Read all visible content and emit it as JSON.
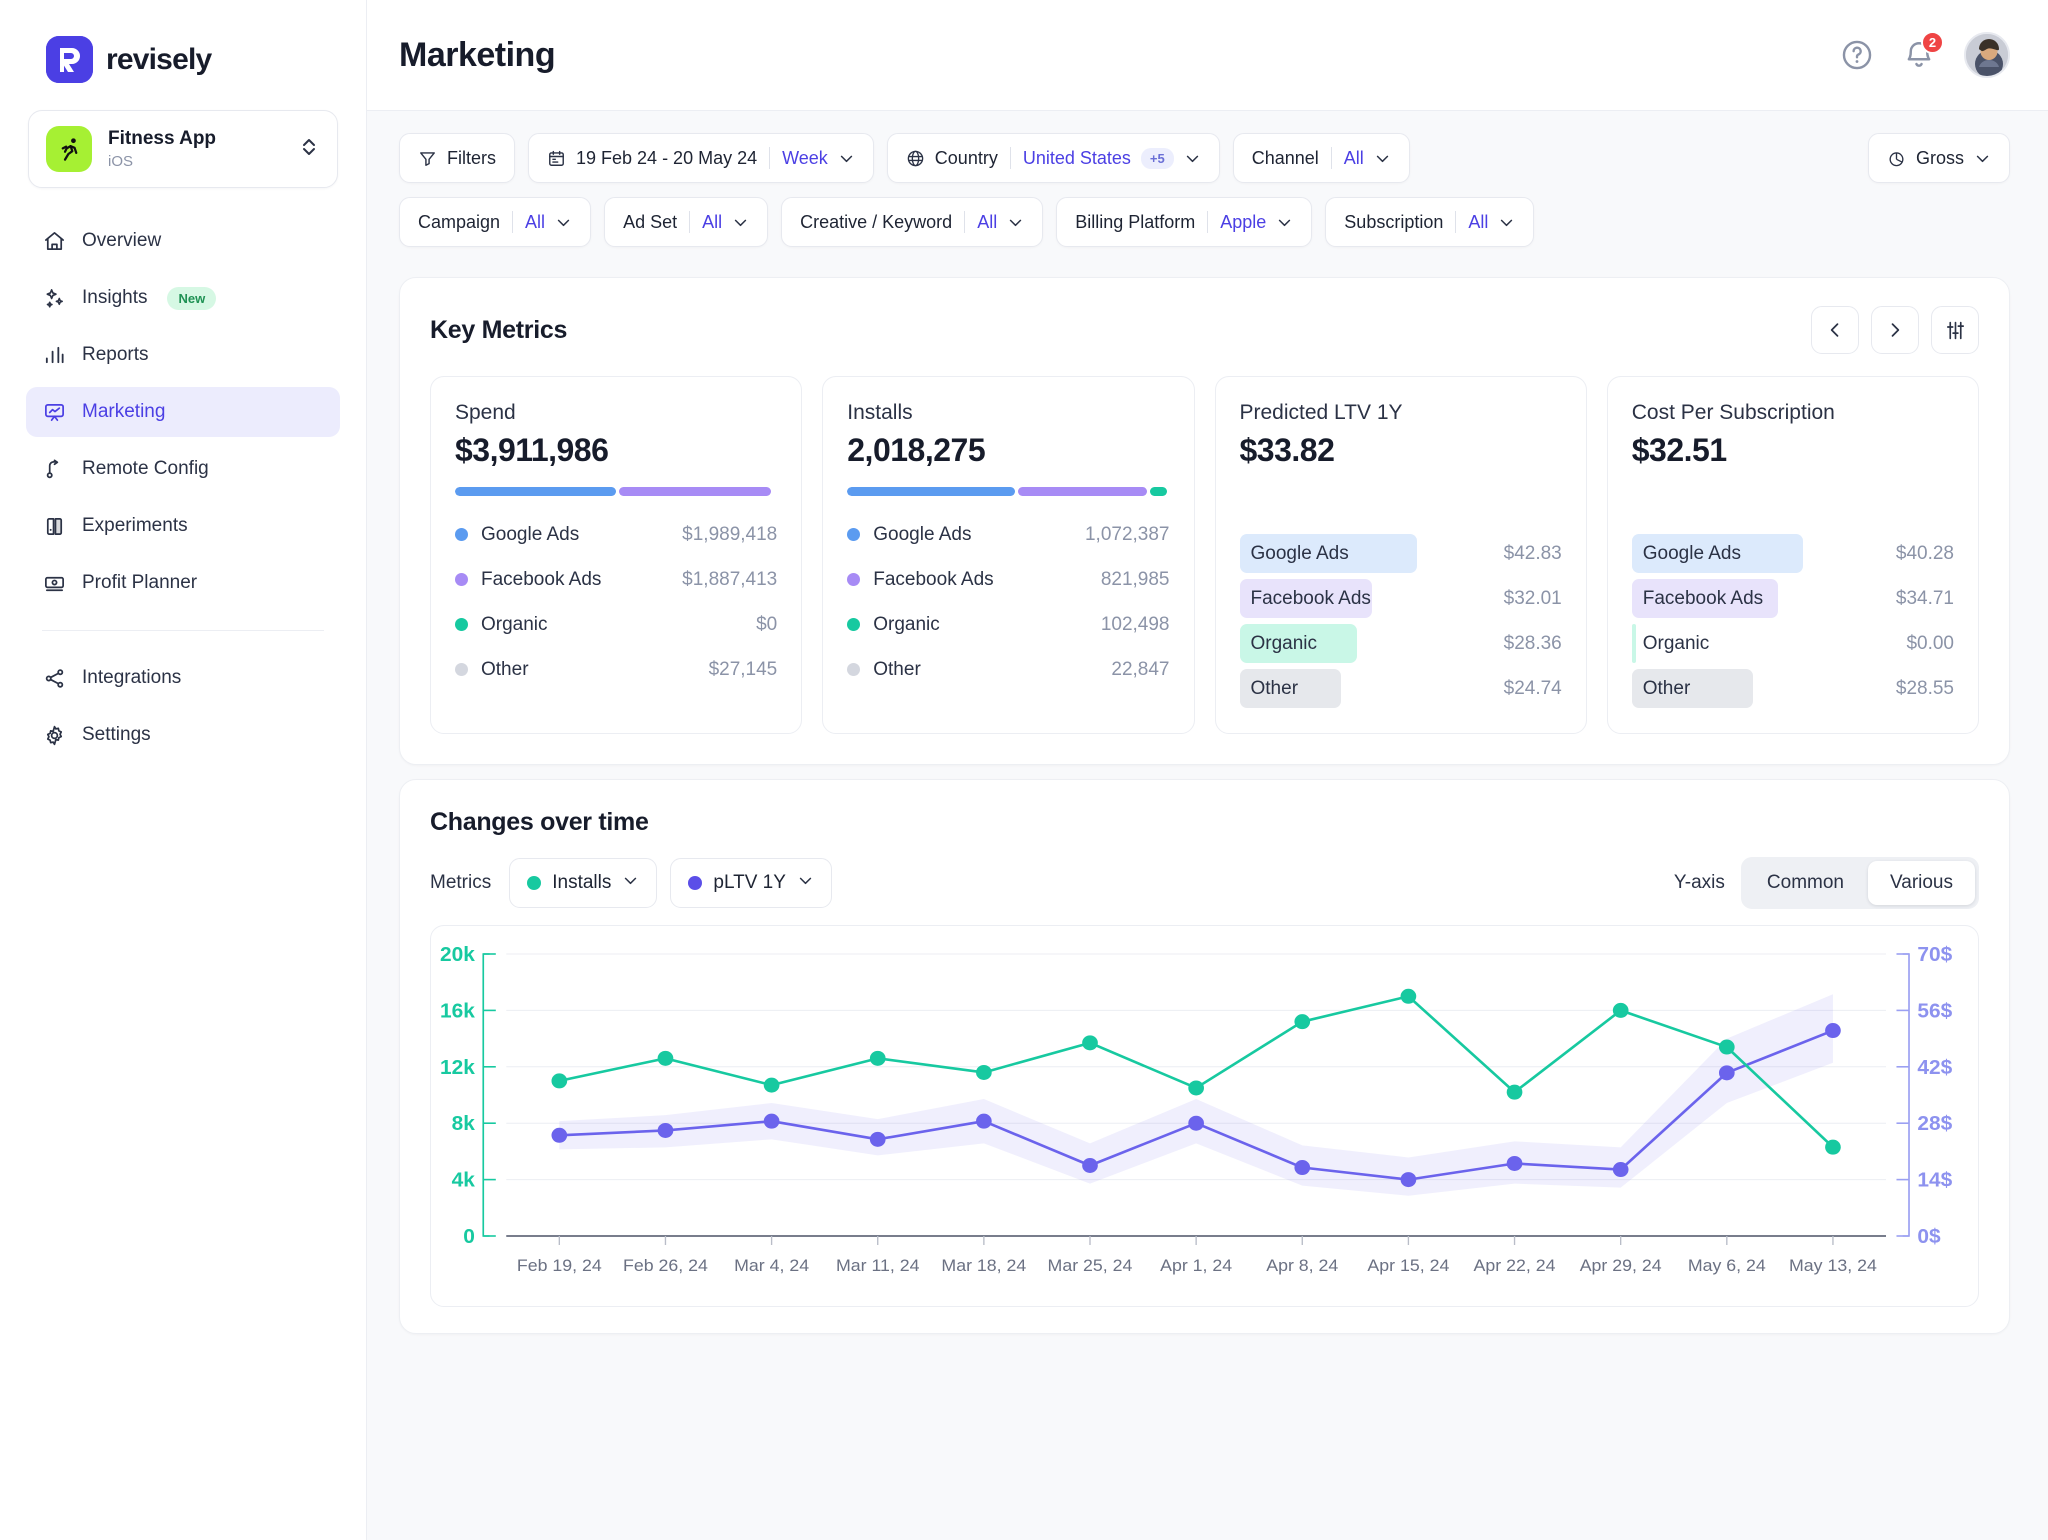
{
  "brand": {
    "name": "revisely",
    "logo_icon": "revisely-logo-icon"
  },
  "app_switcher": {
    "name": "Fitness App",
    "platform": "iOS",
    "icon": "running-person-icon",
    "chevron_icon": "chevron-up-down-icon"
  },
  "sidebar": {
    "items": [
      {
        "label": "Overview",
        "icon": "home-icon",
        "active": false
      },
      {
        "label": "Insights",
        "icon": "sparkles-icon",
        "active": false,
        "badge": "New"
      },
      {
        "label": "Reports",
        "icon": "bar-chart-icon",
        "active": false
      },
      {
        "label": "Marketing",
        "icon": "presentation-chart-icon",
        "active": true
      },
      {
        "label": "Remote Config",
        "icon": "branch-icon",
        "active": false
      },
      {
        "label": "Experiments",
        "icon": "flask-split-icon",
        "active": false
      },
      {
        "label": "Profit Planner",
        "icon": "banknote-icon",
        "active": false
      }
    ],
    "footer_items": [
      {
        "label": "Integrations",
        "icon": "share-nodes-icon"
      },
      {
        "label": "Settings",
        "icon": "gear-icon"
      }
    ]
  },
  "header": {
    "title": "Marketing",
    "help_icon": "question-circle-icon",
    "notifications_icon": "bell-icon",
    "notifications_count": "2",
    "avatar": "user-avatar"
  },
  "filters": {
    "row1": [
      {
        "type": "button",
        "name": "filters-button",
        "icon": "funnel-icon",
        "label": "Filters"
      },
      {
        "type": "daterange",
        "name": "date-range-filter",
        "icon": "calendar-icon",
        "label": "19 Feb 24 - 20 May 24",
        "value": "Week",
        "chevron": "chevron-down-icon"
      },
      {
        "type": "select",
        "name": "country-filter",
        "icon": "globe-icon",
        "label": "Country",
        "value": "United States",
        "extra": "+5",
        "chevron": "chevron-down-icon"
      },
      {
        "type": "select",
        "name": "channel-filter",
        "label": "Channel",
        "value": "All",
        "chevron": "chevron-down-icon"
      }
    ],
    "row2": [
      {
        "type": "select",
        "name": "campaign-filter",
        "label": "Campaign",
        "value": "All",
        "chevron": "chevron-down-icon"
      },
      {
        "type": "select",
        "name": "ad-set-filter",
        "label": "Ad Set",
        "value": "All",
        "chevron": "chevron-down-icon"
      },
      {
        "type": "select",
        "name": "creative-keyword-filter",
        "label": "Creative / Keyword",
        "value": "All",
        "chevron": "chevron-down-icon"
      },
      {
        "type": "select",
        "name": "billing-platform-filter",
        "label": "Billing Platform",
        "value": "Apple",
        "chevron": "chevron-down-icon"
      },
      {
        "type": "select",
        "name": "subscription-filter",
        "label": "Subscription",
        "value": "All",
        "chevron": "chevron-down-icon"
      }
    ],
    "gross": {
      "label": "Gross",
      "icon": "pie-slice-icon",
      "chevron": "chevron-down-icon"
    }
  },
  "key_metrics": {
    "title": "Key Metrics",
    "prev_icon": "chevron-left-icon",
    "next_icon": "chevron-right-icon",
    "settings_icon": "sliders-icon",
    "colors": {
      "google": "#5b9bf0",
      "facebook": "#a78bf5",
      "organic": "#17c9a0",
      "other": "#d4d7df",
      "google_bg": "#dceafc",
      "facebook_bg": "#e8e3fb",
      "organic_bg": "#c9f7e7",
      "other_bg": "#e6e8ec"
    },
    "cards": [
      {
        "label": "Spend",
        "value": "$3,911,986",
        "style": "stacked",
        "rows": [
          {
            "label": "Google Ads",
            "amount": "$1,989,418",
            "share": 50.9
          },
          {
            "label": "Facebook Ads",
            "amount": "$1,887,413",
            "share": 48.3
          },
          {
            "label": "Organic",
            "amount": "$0",
            "share": 0
          },
          {
            "label": "Other",
            "amount": "$27,145",
            "share": 0.8
          }
        ]
      },
      {
        "label": "Installs",
        "value": "2,018,275",
        "style": "stacked",
        "rows": [
          {
            "label": "Google Ads",
            "amount": "1,072,387",
            "share": 53.1
          },
          {
            "label": "Facebook Ads",
            "amount": "821,985",
            "share": 40.7
          },
          {
            "label": "Organic",
            "amount": "102,498",
            "share": 5.1
          },
          {
            "label": "Other",
            "amount": "22,847",
            "share": 1.1
          }
        ]
      },
      {
        "label": "Predicted LTV 1Y",
        "value": "$33.82",
        "style": "bars",
        "rows": [
          {
            "label": "Google Ads",
            "amount": "$42.83",
            "share": 100
          },
          {
            "label": "Facebook Ads",
            "amount": "$32.01",
            "share": 74.7
          },
          {
            "label": "Organic",
            "amount": "$28.36",
            "share": 66.2
          },
          {
            "label": "Other",
            "amount": "$24.74",
            "share": 57.8
          }
        ]
      },
      {
        "label": "Cost Per Subscription",
        "value": "$32.51",
        "style": "bars",
        "rows": [
          {
            "label": "Google Ads",
            "amount": "$40.28",
            "share": 100
          },
          {
            "label": "Facebook Ads",
            "amount": "$34.71",
            "share": 86.2
          },
          {
            "label": "Organic",
            "amount": "$0.00",
            "share": 0.6
          },
          {
            "label": "Other",
            "amount": "$28.55",
            "share": 70.9
          }
        ]
      }
    ]
  },
  "changes_over_time": {
    "title": "Changes over time",
    "metrics_label": "Metrics",
    "metric_pills": [
      {
        "label": "Installs",
        "color": "#17c9a0",
        "chevron": "chevron-down-icon"
      },
      {
        "label": "pLTV 1Y",
        "color": "#5b4fe8",
        "chevron": "chevron-down-icon"
      }
    ],
    "yaxis_label": "Y-axis",
    "yaxis_options": [
      {
        "label": "Common",
        "selected": false
      },
      {
        "label": "Various",
        "selected": true
      }
    ]
  },
  "chart_data": {
    "type": "line",
    "title": "Changes over time",
    "x": [
      "Feb 19, 24",
      "Feb 26, 24",
      "Mar 4, 24",
      "Mar 11, 24",
      "Mar 18, 24",
      "Mar 25, 24",
      "Apr 1, 24",
      "Apr 8, 24",
      "Apr 15, 24",
      "Apr 22, 24",
      "Apr 29, 24",
      "May 6, 24",
      "May 13, 24"
    ],
    "xlabel": "",
    "grid": true,
    "legend": "top-left",
    "left_axis": {
      "label": "Installs",
      "color": "#17c9a0",
      "ticks": [
        "0",
        "4k",
        "8k",
        "12k",
        "16k",
        "20k"
      ],
      "range": [
        0,
        20000
      ]
    },
    "right_axis": {
      "label": "pLTV 1Y",
      "color": "#7b7ef0",
      "ticks": [
        "0$",
        "14$",
        "28$",
        "42$",
        "56$",
        "70$"
      ],
      "range": [
        0,
        70
      ]
    },
    "series": [
      {
        "name": "Installs",
        "axis": "left",
        "color": "#17c9a0",
        "values": [
          11000,
          12600,
          10700,
          12600,
          11600,
          13700,
          10500,
          15200,
          17000,
          10200,
          16000,
          13400,
          6300
        ]
      },
      {
        "name": "pLTV 1Y",
        "axis": "right",
        "color": "#6b63ec",
        "values": [
          25.0,
          26.2,
          28.5,
          24.0,
          28.5,
          17.5,
          28.0,
          17.0,
          14.0,
          18.0,
          16.5,
          40.5,
          51.0
        ],
        "band_lower": [
          21.5,
          22.0,
          24.0,
          20.0,
          23.0,
          13.0,
          23.0,
          12.5,
          10.0,
          13.0,
          12.0,
          33.0,
          43.0
        ],
        "band_upper": [
          28.5,
          30.0,
          33.0,
          29.0,
          34.0,
          23.0,
          34.0,
          22.5,
          19.5,
          23.5,
          22.0,
          49.0,
          60.0
        ]
      }
    ]
  }
}
